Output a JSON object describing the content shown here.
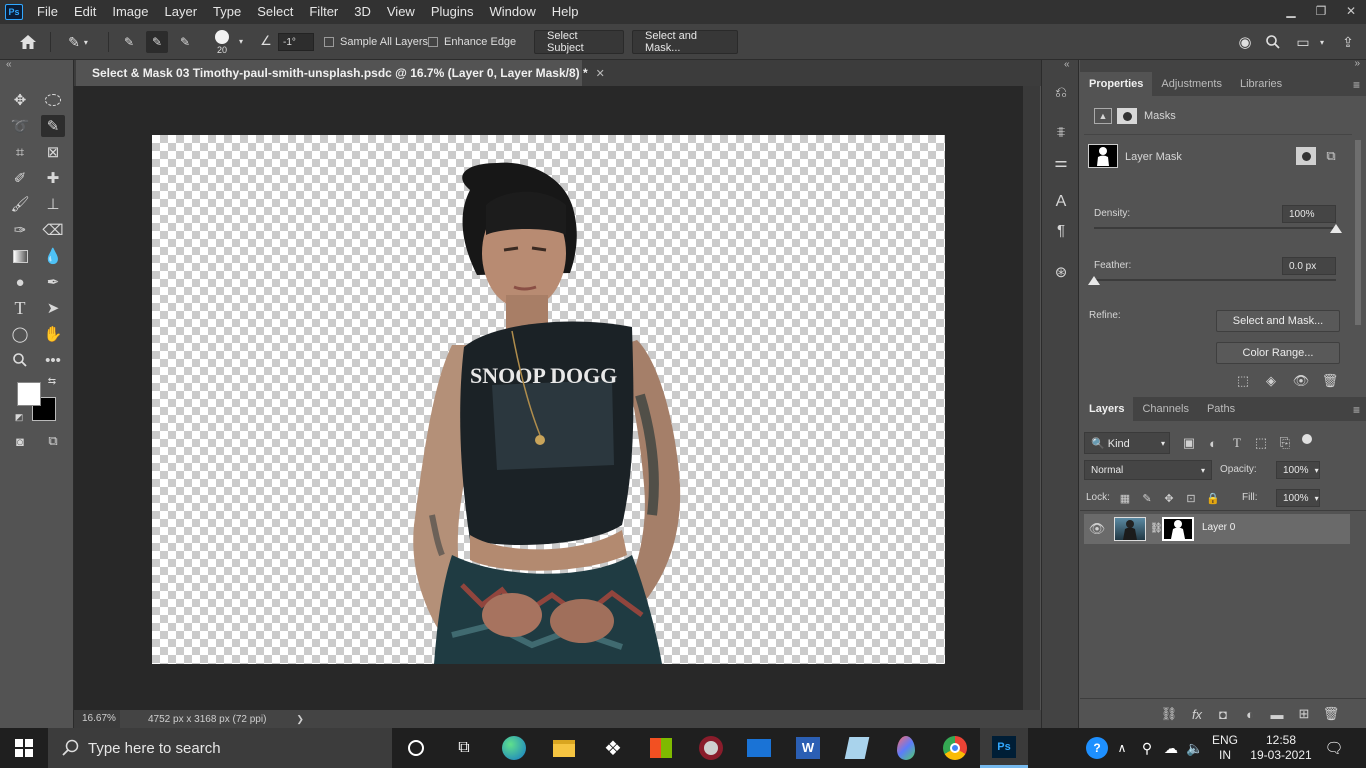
{
  "menubar": {
    "logo": "Ps",
    "items": [
      "File",
      "Edit",
      "Image",
      "Layer",
      "Type",
      "Select",
      "Filter",
      "3D",
      "View",
      "Plugins",
      "Window",
      "Help"
    ],
    "window_controls": [
      "minimize-icon",
      "restore-icon",
      "close-icon"
    ]
  },
  "options_bar": {
    "brush_size": "20",
    "angle": "-1°",
    "sample_all_layers": "Sample All Layers",
    "enhance_edge": "Enhance Edge",
    "select_subject": "Select Subject",
    "select_and_mask": "Select and Mask..."
  },
  "document": {
    "tab_title": "Select & Mask 03 Timothy-paul-smith-unsplash.psdc @ 16.7% (Layer 0, Layer Mask/8) *",
    "zoom": "16.67%",
    "dimensions": "4752 px x 3168 px (72 ppi)",
    "status_arrow": "❯",
    "shirt_text": "SNOOP DOGG"
  },
  "colors": {
    "foreground": "#ffffff",
    "background": "#000000",
    "accent": "#31a8ff"
  },
  "properties_panel": {
    "tabs": [
      "Properties",
      "Adjustments",
      "Libraries"
    ],
    "section": "Masks",
    "mask_label": "Layer Mask",
    "density_label": "Density:",
    "density_value": "100%",
    "density_level": 1.0,
    "feather_label": "Feather:",
    "feather_value": "0.0 px",
    "feather_level": 0.0,
    "refine_label": "Refine:",
    "select_and_mask_button": "Select and Mask...",
    "color_range_button": "Color Range..."
  },
  "layers_panel": {
    "tabs": [
      "Layers",
      "Channels",
      "Paths"
    ],
    "kind_filter": "Kind",
    "blend_mode": "Normal",
    "opacity_label": "Opacity:",
    "opacity_value": "100%",
    "lock_label": "Lock:",
    "fill_label": "Fill:",
    "fill_value": "100%",
    "layers": [
      {
        "name": "Layer 0",
        "visible": true
      }
    ],
    "footer_fx": "fx"
  },
  "taskbar": {
    "search_placeholder": "Type here to search",
    "language_line1": "ENG",
    "language_line2": "IN",
    "time": "12:58",
    "date": "19-03-2021",
    "apps": [
      "cortana-icon",
      "task-view-icon",
      "edge-icon",
      "file-explorer-icon",
      "dropbox-icon",
      "store-icon",
      "media-icon",
      "mail-icon",
      "word-icon",
      "notepad-icon",
      "maps-icon",
      "chrome-icon",
      "photoshop-icon"
    ]
  }
}
